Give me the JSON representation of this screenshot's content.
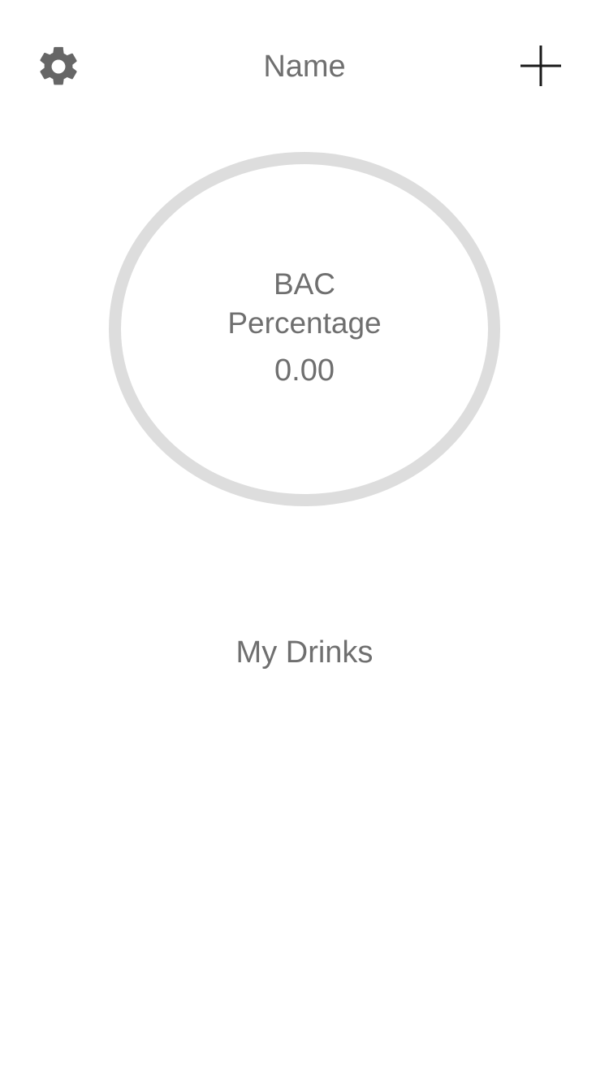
{
  "header": {
    "title": "Name",
    "settings_icon": "gear-icon",
    "add_icon": "plus-icon"
  },
  "bac": {
    "label_line1": "BAC",
    "label_line2": "Percentage",
    "value": "0.00"
  },
  "drinks": {
    "title": "My Drinks"
  },
  "colors": {
    "text": "#6f6f6f",
    "ring": "#dddddd",
    "icon_dark": "#1a1a1a",
    "gear": "#666666"
  }
}
